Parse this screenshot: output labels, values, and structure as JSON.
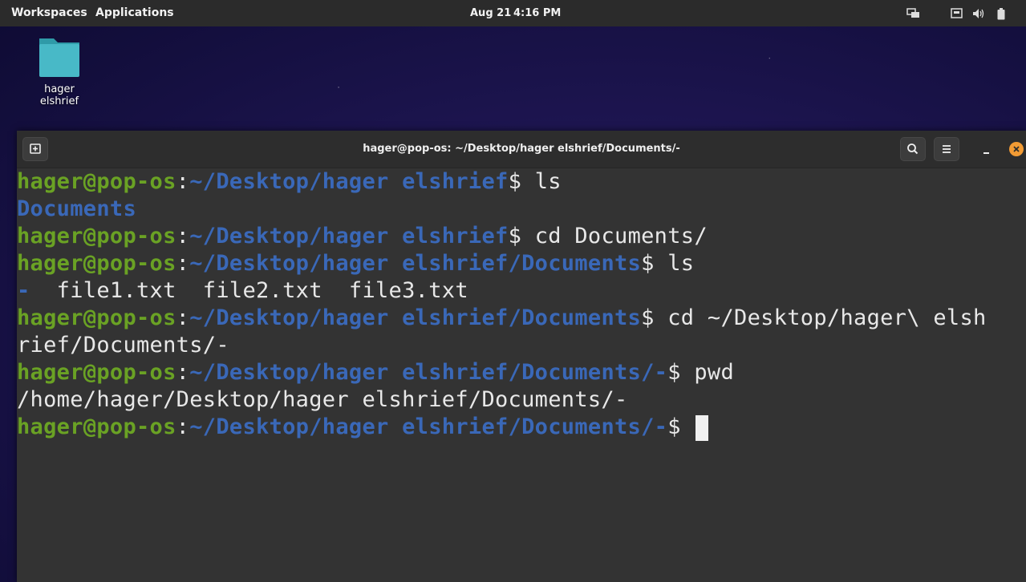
{
  "topbar": {
    "workspaces": "Workspaces",
    "applications": "Applications",
    "date": "Aug 21",
    "time": "4:16 PM",
    "tray_icons": [
      "display-icon",
      "network-icon",
      "volume-icon",
      "battery-icon"
    ]
  },
  "desktop": {
    "folder_label": "hager elshrief",
    "folder_color": "#48b9c7"
  },
  "terminal": {
    "title": "hager@pop-os: ~/Desktop/hager elshrief/Documents/-",
    "lines": [
      {
        "user": "hager@pop-os",
        "sep": ":",
        "path": "~/Desktop/hager elshrief",
        "cmd": "$ ls"
      },
      {
        "dir": "Documents"
      },
      {
        "user": "hager@pop-os",
        "sep": ":",
        "path": "~/Desktop/hager elshrief",
        "cmd": "$ cd Documents/"
      },
      {
        "user": "hager@pop-os",
        "sep": ":",
        "path": "~/Desktop/hager elshrief/Documents",
        "cmd": "$ ls"
      },
      {
        "dir": "-",
        "rest": "  file1.txt  file2.txt  file3.txt"
      },
      {
        "user": "hager@pop-os",
        "sep": ":",
        "path": "~/Desktop/hager elshrief/Documents",
        "cmd": "$ cd ~/Desktop/hager\\ elsh"
      },
      {
        "plain": "rief/Documents/-"
      },
      {
        "user": "hager@pop-os",
        "sep": ":",
        "path": "~/Desktop/hager elshrief/Documents/-",
        "cmd": "$ pwd"
      },
      {
        "plain": "/home/hager/Desktop/hager elshrief/Documents/-"
      },
      {
        "user": "hager@pop-os",
        "sep": ":",
        "path": "~/Desktop/hager elshrief/Documents/-",
        "cmd": "$ "
      }
    ]
  },
  "colors": {
    "user_green": "#6aa224",
    "path_blue": "#3a68b8",
    "terminal_bg": "#333333",
    "close_orange": "#f29b34"
  }
}
